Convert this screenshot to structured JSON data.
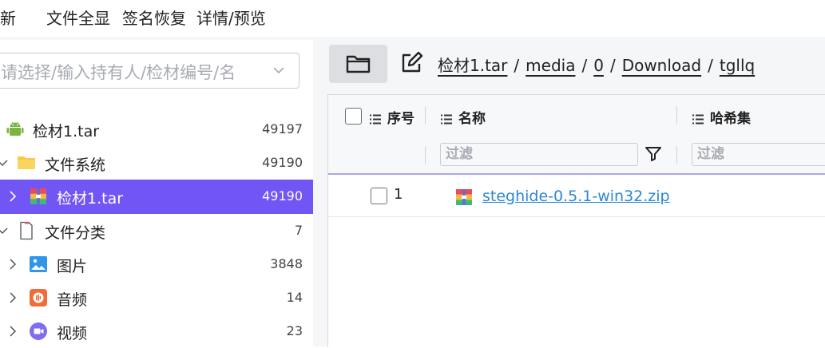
{
  "toolbar": {
    "refresh_label": "刷新",
    "show_all_files_label": "文件全显",
    "signature_restore_label": "签名恢复",
    "detail_preview_label": "详情/预览"
  },
  "evidence_select": {
    "placeholder": "请选择/输入持有人/检材编号/名"
  },
  "tree": [
    {
      "label": "检材1.tar",
      "count": "49197",
      "icon": "android-icon"
    },
    {
      "label": "文件系统",
      "count": "49190",
      "icon": "folder-icon"
    },
    {
      "label": "检材1.tar",
      "count": "49190",
      "icon": "archive-icon"
    },
    {
      "label": "文件分类",
      "count": "7",
      "icon": "document-icon"
    },
    {
      "label": "图片",
      "count": "3848",
      "icon": "image-icon"
    },
    {
      "label": "音频",
      "count": "14",
      "icon": "audio-icon"
    },
    {
      "label": "视频",
      "count": "23",
      "icon": "video-icon"
    }
  ],
  "path": {
    "crumbs": [
      "检材1.tar",
      "media",
      "0",
      "Download",
      "tgllq"
    ],
    "separator": "/"
  },
  "grid": {
    "columns": {
      "index": "序号",
      "name": "名称",
      "hashset": "哈希集"
    },
    "filter_placeholder": "过滤",
    "rows": [
      {
        "index": "1",
        "name": "steghide-0.5.1-win32.zip"
      }
    ]
  },
  "colors": {
    "accent": "#7255f5",
    "link": "#2a87d6"
  }
}
